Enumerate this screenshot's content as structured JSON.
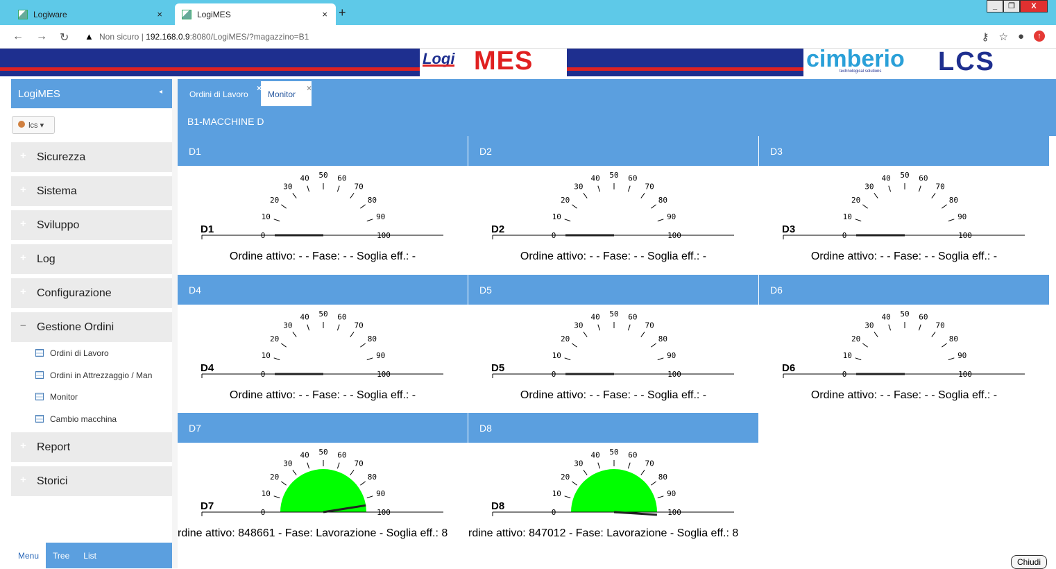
{
  "browser": {
    "tabs": [
      {
        "label": "Logiware",
        "close": "×"
      },
      {
        "label": "LogiMES",
        "close": "×"
      }
    ],
    "new_tab": "+",
    "window_buttons": {
      "minimize": "_",
      "maximize": "❐",
      "close": "X"
    },
    "address": {
      "security": "Non sicuro",
      "separator": "|",
      "host": "192.168.0.9",
      "path": ":8080/LogiMES/?magazzino=B1"
    }
  },
  "banner": {
    "logo_logi": "Logi",
    "logo_mes": "MES",
    "logo_cimberio": "cimberio",
    "logo_cimberio_tag": "technological solutions",
    "logo_lcs": "LCS"
  },
  "sidebar": {
    "title": "LogiMES",
    "collapse": "◂",
    "user": "lcs",
    "groups_top": [
      {
        "label": "Sicurezza",
        "sign": "+"
      },
      {
        "label": "Sistema",
        "sign": "+"
      },
      {
        "label": "Sviluppo",
        "sign": "+"
      },
      {
        "label": "Log",
        "sign": "+"
      },
      {
        "label": "Configurazione",
        "sign": "+"
      }
    ],
    "open_group": {
      "label": "Gestione Ordini",
      "sign": "−"
    },
    "sub_items": [
      {
        "label": "Ordini di Lavoro"
      },
      {
        "label": "Ordini in Attrezzaggio / Man"
      },
      {
        "label": "Monitor"
      },
      {
        "label": "Cambio macchina"
      }
    ],
    "groups_bottom": [
      {
        "label": "Report",
        "sign": "+"
      },
      {
        "label": "Storici",
        "sign": "+"
      }
    ],
    "footer_tabs": [
      "Menu",
      "Tree",
      "List"
    ]
  },
  "main": {
    "tabs": [
      {
        "label": "Ordini di Lavoro",
        "close": "×"
      },
      {
        "label": "Monitor",
        "close": "×"
      }
    ],
    "section_title": "B1-MACCHINE D",
    "gauge_ticks": [
      "0",
      "10",
      "20",
      "30",
      "40",
      "50",
      "60",
      "70",
      "80",
      "90",
      "100"
    ],
    "machines": [
      {
        "id": "D1",
        "value": 0,
        "active": false,
        "status": "Ordine attivo: - - Fase: - - Soglia eff.: -"
      },
      {
        "id": "D2",
        "value": 0,
        "active": false,
        "status": "Ordine attivo: - - Fase: - - Soglia eff.: -"
      },
      {
        "id": "D3",
        "value": 0,
        "active": false,
        "status": "Ordine attivo: - - Fase: - - Soglia eff.: -"
      },
      {
        "id": "D4",
        "value": 0,
        "active": false,
        "status": "Ordine attivo: - - Fase: - - Soglia eff.: -"
      },
      {
        "id": "D5",
        "value": 0,
        "active": false,
        "status": "Ordine attivo: - - Fase: - - Soglia eff.: -"
      },
      {
        "id": "D6",
        "value": 0,
        "active": false,
        "status": "Ordine attivo: - - Fase: - - Soglia eff.: -"
      },
      {
        "id": "D7",
        "value": 95,
        "active": true,
        "status": "rdine attivo: 848661 - Fase: Lavorazione - Soglia eff.: 8"
      },
      {
        "id": "D8",
        "value": 102,
        "active": true,
        "status": "rdine attivo: 847012 - Fase: Lavorazione - Soglia eff.: 8"
      }
    ],
    "close_button": "Chiudi"
  },
  "colors": {
    "header_blue": "#5b9fdf",
    "gauge_green": "#00ff00",
    "banner_navy": "#1e2f8f",
    "banner_red": "#dd2222"
  }
}
